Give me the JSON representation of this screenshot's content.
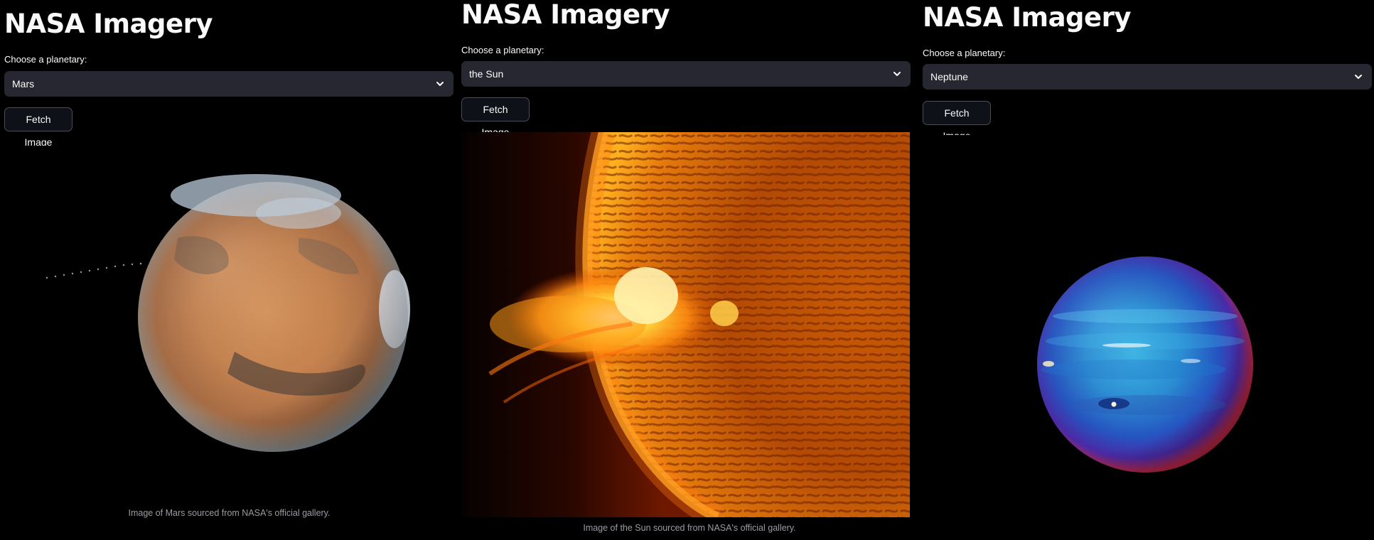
{
  "panels": [
    {
      "title": "NASA Imagery",
      "select_label": "Choose a planetary:",
      "selected": "Mars",
      "button_label": "Fetch Image",
      "caption": "Image of Mars sourced from NASA's official gallery."
    },
    {
      "title": "NASA Imagery",
      "select_label": "Choose a planetary:",
      "selected": "the Sun",
      "button_label": "Fetch Image",
      "caption": "Image of the Sun sourced from NASA's official gallery."
    },
    {
      "title": "NASA Imagery",
      "select_label": "Choose a planetary:",
      "selected": "Neptune",
      "button_label": "Fetch Image",
      "caption": ""
    }
  ],
  "colors": {
    "background": "#000000",
    "select_bg": "#262730",
    "button_border": "#4a4d57",
    "text": "#fafafa",
    "caption": "#9a9ca3"
  },
  "icons": {
    "select_toggle": "chevron-down-icon"
  }
}
